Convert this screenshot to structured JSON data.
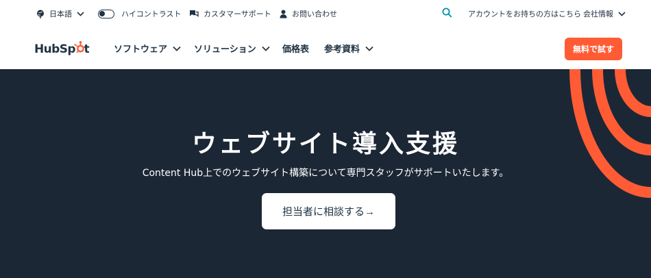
{
  "utility_bar": {
    "language": "日本語",
    "high_contrast": "ハイコントラスト",
    "support": "カスタマーサポート",
    "contact": "お問い合わせ",
    "login": "アカウントをお持ちの方はこちら",
    "company": "会社情報"
  },
  "nav": {
    "logo": "HubSpot",
    "items": [
      {
        "label": "ソフトウェア",
        "dropdown": true
      },
      {
        "label": "ソリューション",
        "dropdown": true
      },
      {
        "label": "価格表",
        "dropdown": false
      },
      {
        "label": "参考資料",
        "dropdown": true
      }
    ],
    "cta": "無料で試す"
  },
  "hero": {
    "title": "ウェブサイト導入支援",
    "subtitle": "Content Hub上でのウェブサイト構築について専門スタッフがサポートいたします。",
    "button": "担当者に相談する→"
  },
  "colors": {
    "brand_orange": "#ff5c35",
    "hero_bg": "#1c2735",
    "text_dark": "#213343",
    "link_blue": "#0091ae"
  },
  "icons": [
    "globe-icon",
    "contrast-toggle-icon",
    "chat-icon",
    "person-icon",
    "search-icon",
    "chevron-down-icon"
  ]
}
